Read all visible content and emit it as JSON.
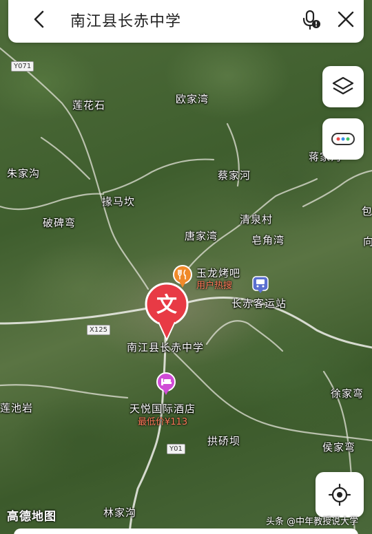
{
  "search": {
    "query": "南江县长赤中学"
  },
  "roads": [
    {
      "id": "Y071",
      "label": "Y071"
    },
    {
      "id": "X125",
      "label": "X125"
    },
    {
      "id": "Y01",
      "label": "Y01"
    }
  ],
  "places": {
    "lianhuashi": "莲花石",
    "oujiawan": "欧家湾",
    "zhujiagou": "朱家沟",
    "jiangjiagou": "蒋家沟",
    "caijiahe": "蔡家河",
    "yuanmakan": "掾马坎",
    "pobeiwan": "破碑弯",
    "qingquancun": "清泉村",
    "tangjiawan": "唐家湾",
    "zaojiaowan": "皂角湾",
    "bao": "包",
    "xiang": "向",
    "lianchiyan": "莲池岩",
    "xujiawan": "徐家弯",
    "gongqiaoba": "拱硚坝",
    "houjiawan": "侯家弯",
    "linjiagou": "林家沟"
  },
  "pois": {
    "yulong": {
      "name": "玉龙烤吧",
      "sub": "用户热搜",
      "icon": "fork-knife-icon",
      "color": "#f08a2a"
    },
    "station": {
      "name": "长赤客运站",
      "icon": "bus-icon",
      "color": "#5a6fd0"
    },
    "hotel": {
      "name": "天悦国际酒店",
      "sub": "最低价¥113",
      "icon": "bed-icon",
      "color": "#d04bd6"
    }
  },
  "selected": {
    "name": "南江县长赤中学",
    "marker_glyph": "文",
    "marker_color": "#e83a45"
  },
  "controls": {
    "layers": "layers-icon",
    "more": "more-dots-icon",
    "locate": "locate-icon"
  },
  "branding": {
    "logo": "高德地图",
    "watermark": "头条 @中年教授说大学"
  }
}
